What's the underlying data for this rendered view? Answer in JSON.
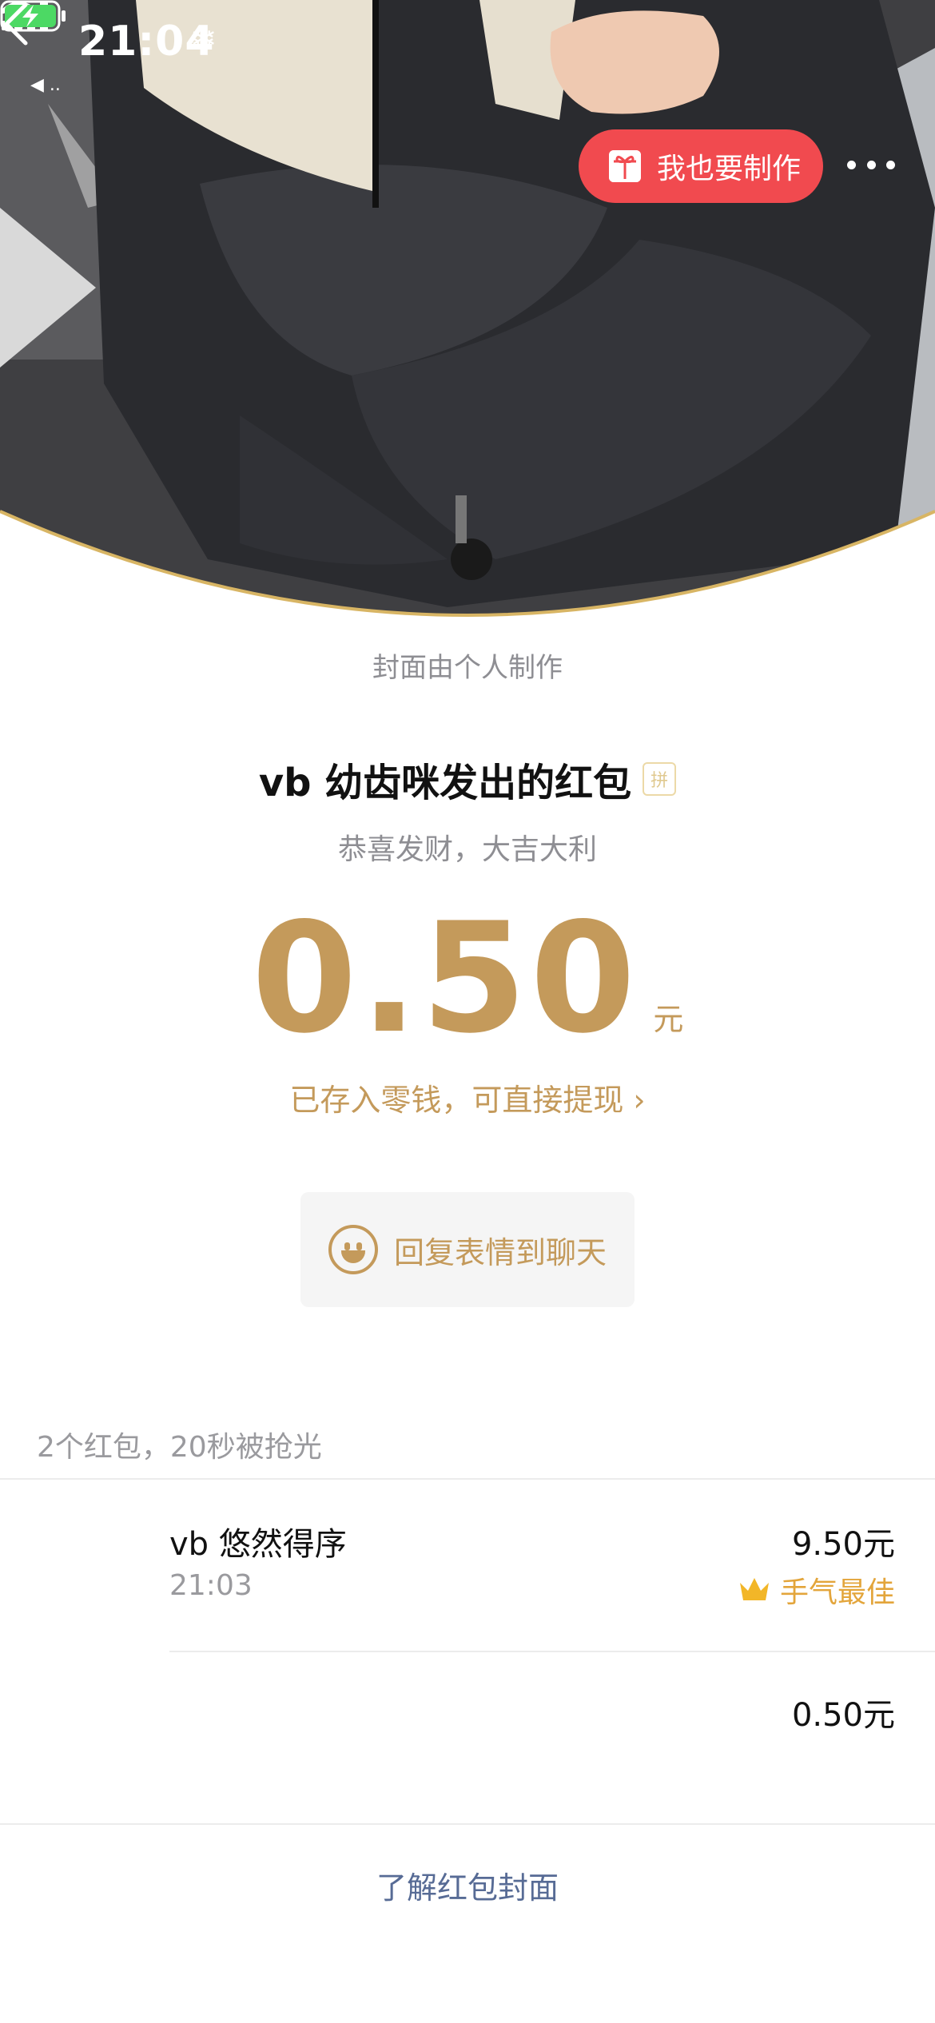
{
  "status_bar": {
    "time": "21:04",
    "back_app": "◀ .."
  },
  "nav": {
    "make_button_label": "我也要制作"
  },
  "cover": {
    "note": "封面由个人制作"
  },
  "packet": {
    "sender_title": "vb 幼齿咪发出的红包",
    "pin_badge": "拼",
    "greeting": "恭喜发财，大吉大利",
    "amount": "0.50",
    "unit": "元",
    "wallet_note": "已存入零钱，可直接提现",
    "reply_label": "回复表情到聊天"
  },
  "records": {
    "summary": "2个红包，20秒被抢光",
    "items": [
      {
        "name": "vb 悠然得序",
        "time": "21:03",
        "amount": "9.50元",
        "best_label": "手气最佳"
      },
      {
        "name": "",
        "time": "",
        "amount": "0.50元"
      }
    ]
  },
  "footer": {
    "link": "了解红包封面"
  },
  "colors": {
    "gold": "#c49a5b",
    "red_button": "#f14a4f",
    "best_orange": "#e3a53b",
    "link_blue": "#576b95"
  },
  "icons": [
    "back-chevron-icon",
    "gift-icon",
    "more-icon",
    "signal-icon",
    "wifi-icon",
    "battery-charging-icon",
    "snowflake-icon",
    "smiley-icon",
    "crown-icon",
    "chevron-right-icon"
  ]
}
